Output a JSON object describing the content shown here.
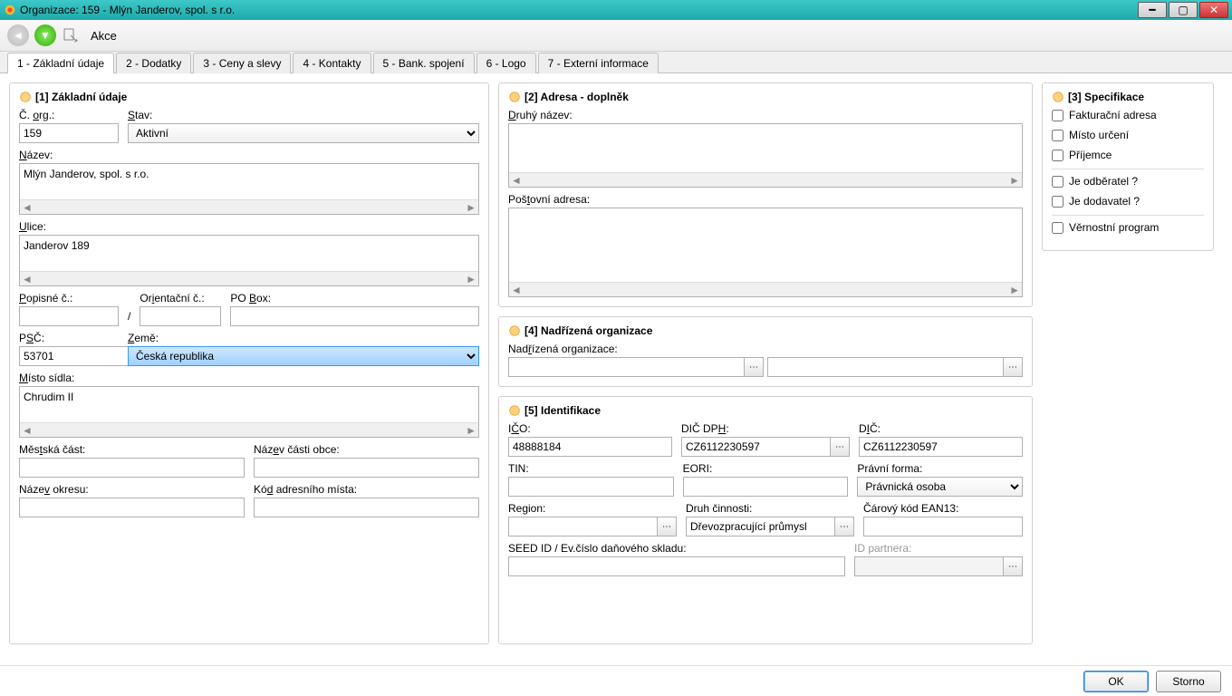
{
  "window": {
    "title": "Organizace: 159 - Mlýn Janderov, spol. s r.o."
  },
  "toolbar": {
    "akce": "Akce"
  },
  "tabs": [
    "1 - Základní údaje",
    "2 - Dodatky",
    "3 - Ceny a slevy",
    "4 - Kontakty",
    "5 - Bank. spojení",
    "6 - Logo",
    "7 - Externí informace"
  ],
  "g1": {
    "title": "[1] Základní údaje",
    "corg_label": "Č. org.:",
    "corg": "159",
    "stav_label": "Stav:",
    "stav": "Aktivní",
    "nazev_label": "Název:",
    "nazev": "Mlýn Janderov, spol. s r.o.",
    "ulice_label": "Ulice:",
    "ulice": "Janderov 189",
    "popisne_label": "Popisné č.:",
    "popisne": "",
    "orient_label": "Orientační č.:",
    "orient": "",
    "pobox_label": "PO Box:",
    "pobox": "",
    "psc_label": "PSČ:",
    "psc": "53701",
    "zeme_label": "Země:",
    "zeme": "Česká republika",
    "misto_label": "Místo sídla:",
    "misto": "Chrudim II",
    "mestska_label": "Městská část:",
    "mestska": "",
    "castobce_label": "Název části obce:",
    "castobce": "",
    "okres_label": "Název okresu:",
    "okres": "",
    "kodadr_label": "Kód adresního místa:",
    "kodadr": ""
  },
  "g2": {
    "title": "[2] Adresa - doplněk",
    "druhy_label": "Druhý název:",
    "druhy": "",
    "post_label": "Poštovní adresa:",
    "post": ""
  },
  "g3": {
    "title": "[3] Specifikace",
    "fakturacni": "Fakturační adresa",
    "misto_urceni": "Místo určení",
    "prijemce": "Příjemce",
    "odberatel": "Je odběratel ?",
    "dodavatel": "Je dodavatel ?",
    "vernostni": "Věrnostní program"
  },
  "g4": {
    "title": "[4] Nadřízená organizace",
    "label": "Nadřízená organizace:",
    "value": ""
  },
  "g5": {
    "title": "[5] Identifikace",
    "ico_label": "IČO:",
    "ico": "48888184",
    "dicdph_label": "DIČ DPH:",
    "dicdph": "CZ6112230597",
    "dic_label": "DIČ:",
    "dic": "CZ6112230597",
    "tin_label": "TIN:",
    "tin": "",
    "eori_label": "EORI:",
    "eori": "",
    "pravni_label": "Právní forma:",
    "pravni": "Právnická osoba",
    "region_label": "Region:",
    "region": "",
    "druh_label": "Druh činnosti:",
    "druh": "Dřevozpracující průmysl",
    "ean_label": "Čárový kód EAN13:",
    "ean": "",
    "seed_label": "SEED ID / Ev.číslo daňového skladu:",
    "seed": "",
    "idpartner_label": "ID partnera:",
    "idpartner": ""
  },
  "footer": {
    "ok": "OK",
    "storno": "Storno"
  }
}
